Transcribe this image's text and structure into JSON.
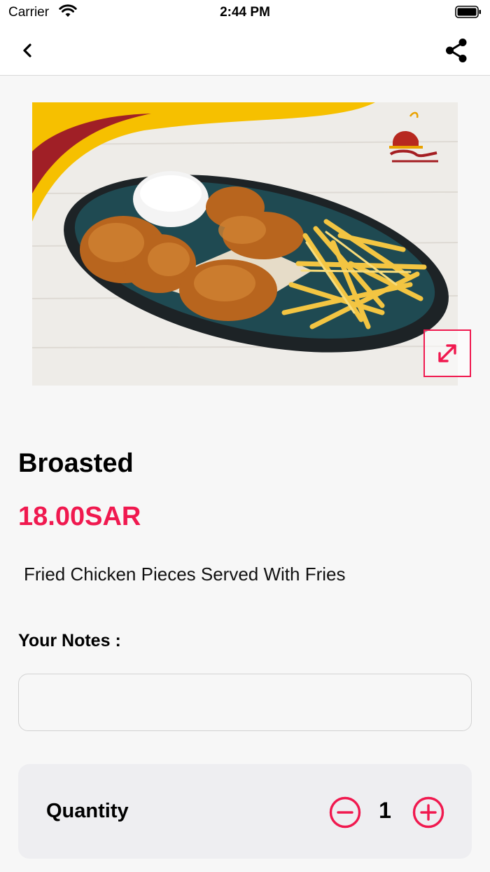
{
  "status_bar": {
    "carrier": "Carrier",
    "time": "2:44 PM"
  },
  "nav": {
    "back_icon": "chevron-left-icon",
    "share_icon": "share-icon"
  },
  "product": {
    "image_description": "Broasted chicken plate with fries",
    "name": "Broasted",
    "price": "18.00SAR",
    "description": "Fried Chicken Pieces Served With Fries"
  },
  "notes": {
    "label": "Your Notes :",
    "value": "",
    "placeholder": ""
  },
  "quantity": {
    "label": "Quantity",
    "value": "1"
  },
  "colors": {
    "accent": "#f0194f",
    "background": "#f7f7f7",
    "card": "#eeeef1"
  }
}
